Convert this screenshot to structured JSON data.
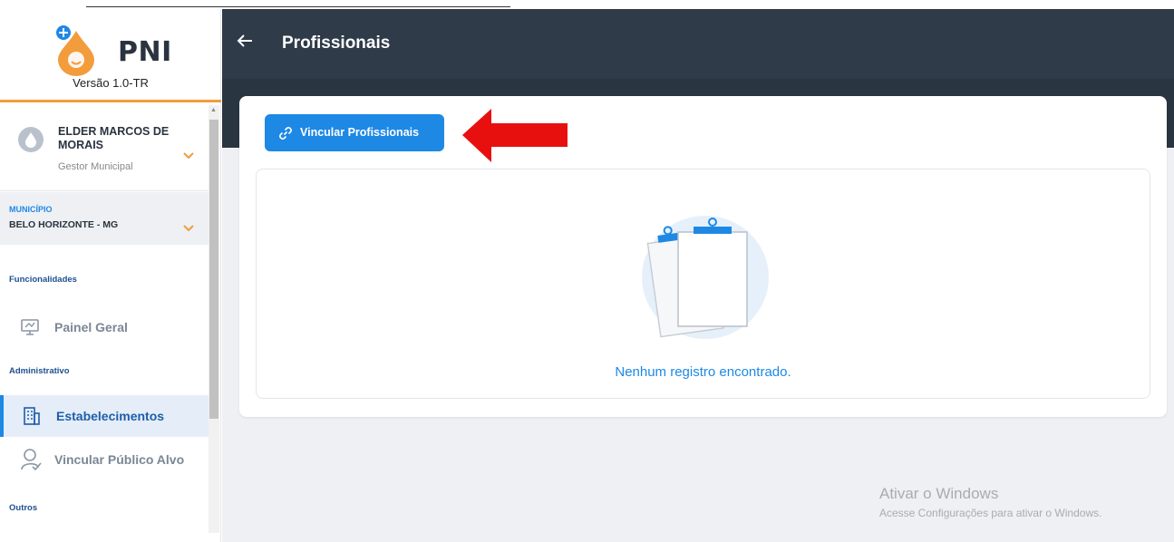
{
  "app": {
    "logo_text": "PNI",
    "version": "Versão 1.0-TR"
  },
  "user": {
    "name": "ELDER MARCOS DE MORAIS",
    "role": "Gestor Municipal"
  },
  "municipio": {
    "label": "MUNICÍPIO",
    "value": "BELO HORIZONTE - MG"
  },
  "sidebar": {
    "sections": [
      {
        "title": "Funcionalidades"
      },
      {
        "title": "Administrativo"
      },
      {
        "title": "Outros"
      }
    ],
    "items": [
      {
        "label": "Painel Geral",
        "icon": "presentation-board-icon"
      },
      {
        "label": "Estabelecimentos",
        "icon": "building-icon",
        "active": true
      },
      {
        "label": "Vincular Público Alvo",
        "icon": "user-check-icon"
      }
    ]
  },
  "header": {
    "title": "Profissionais",
    "back_icon": "arrow-left-icon"
  },
  "main": {
    "vincular_button": "Vincular Profissionais",
    "empty_message": "Nenhum registro encontrado."
  },
  "watermark": {
    "line1": "Ativar o Windows",
    "line2": "Acesse Configurações para ativar o Windows."
  },
  "colors": {
    "accent": "#1e88e5",
    "header": "#2f3b49",
    "brand_orange": "#f39c3c",
    "annotation_arrow": "#e8100f"
  }
}
